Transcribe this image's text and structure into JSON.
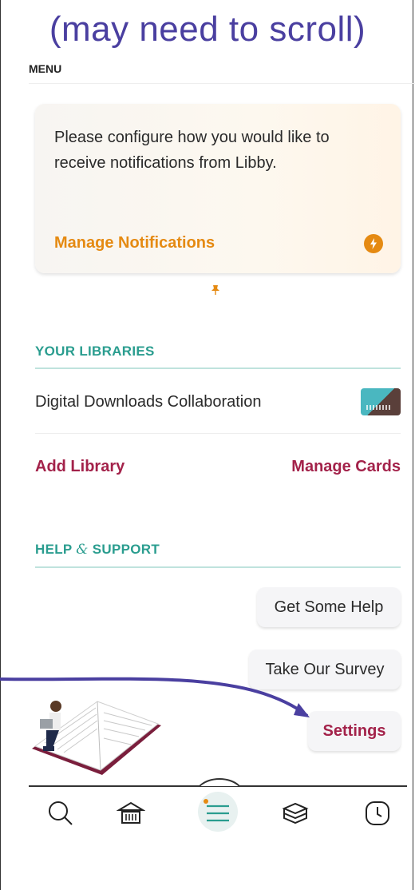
{
  "annotation": {
    "text": "(may need to scroll)",
    "arrow_color": "#4a3fa0"
  },
  "menu": {
    "label": "MENU"
  },
  "notification_card": {
    "message": "Please configure how you would like to receive notifications from Libby.",
    "link_label": "Manage Notifications",
    "accent": "#e58a12",
    "icon": "bolt-icon"
  },
  "libraries": {
    "heading": "YOUR LIBRARIES",
    "items": [
      {
        "name": "Digital Downloads Collaboration",
        "icon": "library-logo"
      }
    ],
    "add_label": "Add Library",
    "manage_label": "Manage Cards"
  },
  "help": {
    "heading_part1": "HELP",
    "heading_amp": "&",
    "heading_part2": "SUPPORT",
    "buttons": [
      "Get Some Help",
      "Take Our Survey",
      "Settings"
    ]
  },
  "nav": {
    "items": [
      {
        "name": "search",
        "icon": "search-icon",
        "active": false
      },
      {
        "name": "libraries",
        "icon": "library-building-icon",
        "active": false
      },
      {
        "name": "menu",
        "icon": "menu-icon",
        "active": true
      },
      {
        "name": "shelf",
        "icon": "books-stack-icon",
        "active": false
      },
      {
        "name": "timeline",
        "icon": "clock-icon",
        "active": false
      }
    ]
  },
  "colors": {
    "teal": "#2a9d8f",
    "maroon": "#a3224a",
    "orange": "#e58a12"
  }
}
